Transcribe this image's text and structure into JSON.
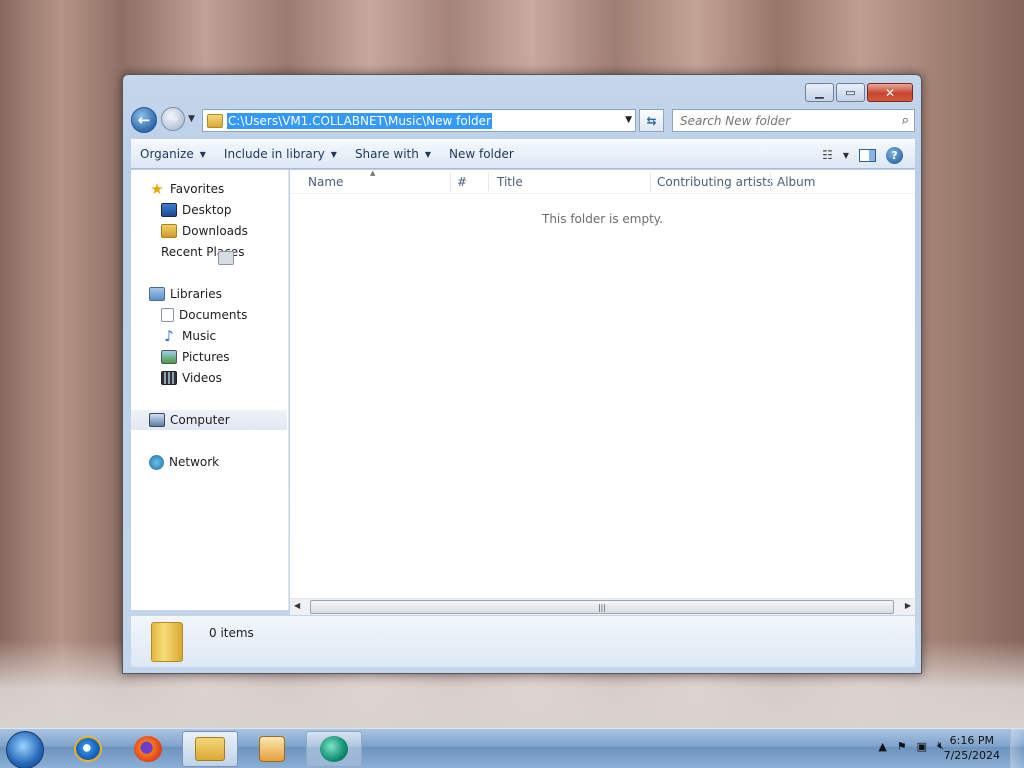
{
  "window": {
    "address_path": "C:\\Users\\VM1.COLLABNET\\Music\\New folder",
    "search_placeholder": "Search New folder"
  },
  "toolbar": {
    "organize": "Organize",
    "include_in_library": "Include in library",
    "share_with": "Share with",
    "new_folder": "New folder"
  },
  "nav": {
    "favorites": "Favorites",
    "desktop": "Desktop",
    "downloads": "Downloads",
    "recent_places": "Recent Places",
    "libraries": "Libraries",
    "documents": "Documents",
    "music": "Music",
    "pictures": "Pictures",
    "videos": "Videos",
    "computer": "Computer",
    "network": "Network"
  },
  "columns": {
    "name": "Name",
    "number": "#",
    "title": "Title",
    "contributing_artists": "Contributing artists",
    "album": "Album"
  },
  "content": {
    "empty_message": "This folder is empty."
  },
  "details": {
    "item_count": "0 items"
  },
  "taskbar": {
    "time": "6:16 PM",
    "date": "7/25/2024"
  },
  "colors": {
    "selection": "#3399ff",
    "toolbar_text": "#1e395b"
  }
}
